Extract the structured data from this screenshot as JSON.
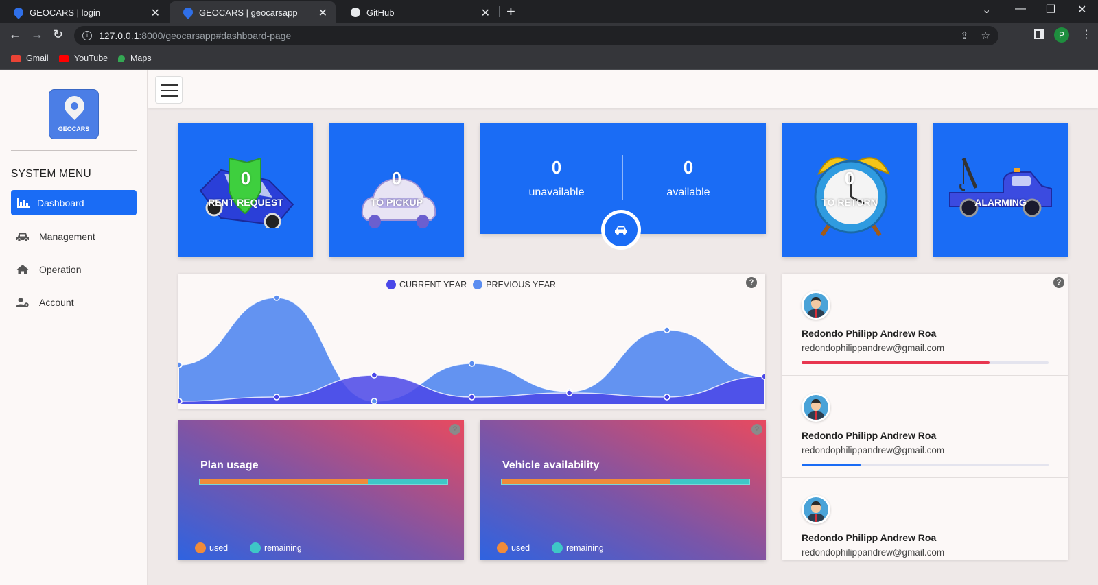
{
  "browser": {
    "tabs": [
      {
        "title": "GEOCARS | login",
        "active": false
      },
      {
        "title": "GEOCARS | geocarsapp",
        "active": true
      },
      {
        "title": "GitHub",
        "active": false
      }
    ],
    "url_host": "127.0.0.1",
    "url_rest": ":8000/geocarsapp#dashboard-page",
    "profile_initial": "P",
    "bookmarks": [
      {
        "label": "Gmail",
        "color": "#ea4335"
      },
      {
        "label": "YouTube",
        "color": "#ff0000"
      },
      {
        "label": "Maps",
        "color": "#34a853"
      }
    ]
  },
  "sidebar": {
    "logo_text": "GEOCARS",
    "menu_title": "SYSTEM MENU",
    "items": [
      {
        "label": "Dashboard",
        "icon": "bar-chart-icon",
        "active": true
      },
      {
        "label": "Management",
        "icon": "car-icon",
        "active": false
      },
      {
        "label": "Operation",
        "icon": "home-icon",
        "active": false
      },
      {
        "label": "Account",
        "icon": "user-gear-icon",
        "active": false
      }
    ]
  },
  "stats": {
    "rent_request": {
      "value": "0",
      "label": "RENT REQUEST"
    },
    "to_pickup": {
      "value": "0",
      "label": "TO PICKUP"
    },
    "unavailable": {
      "value": "0",
      "label": "unavailable"
    },
    "available": {
      "value": "0",
      "label": "available"
    },
    "to_return": {
      "value": "0",
      "label": "TO RETURN"
    },
    "alarming": {
      "value": "0",
      "label": "ALARMING"
    }
  },
  "chart_data": {
    "type": "area",
    "title": "",
    "legend_position": "top-center",
    "grid": false,
    "series": [
      {
        "name": "CURRENT YEAR",
        "color": "#4a47e8",
        "values": [
          4,
          10,
          42,
          10,
          16,
          10,
          40
        ]
      },
      {
        "name": "PREVIOUS YEAR",
        "color": "#5b8df0",
        "values": [
          57,
          155,
          4,
          59,
          18,
          108,
          40
        ]
      }
    ],
    "ylim": [
      0,
      190
    ]
  },
  "plan_usage": {
    "title": "Plan usage",
    "used_fraction": 0.68,
    "legend_used": "used",
    "legend_remaining": "remaining",
    "used_color": "#f08b3a",
    "remaining_color": "#3ec7c7"
  },
  "vehicle_availability": {
    "title": "Vehicle availability",
    "used_fraction": 0.68,
    "legend_used": "used",
    "legend_remaining": "remaining",
    "used_color": "#f08b3a",
    "remaining_color": "#3ec7c7"
  },
  "users": [
    {
      "name": "Redondo Philipp Andrew Roa",
      "email": "redondophilippandrew@gmail.com",
      "progress": 0.76,
      "bar_color": "#e8364f"
    },
    {
      "name": "Redondo Philipp Andrew Roa",
      "email": "redondophilippandrew@gmail.com",
      "progress": 0.24,
      "bar_color": "#1a6cf5"
    },
    {
      "name": "Redondo Philipp Andrew Roa",
      "email": "redondophilippandrew@gmail.com",
      "progress": 0,
      "bar_color": "#1a6cf5"
    }
  ],
  "help_label": "?"
}
